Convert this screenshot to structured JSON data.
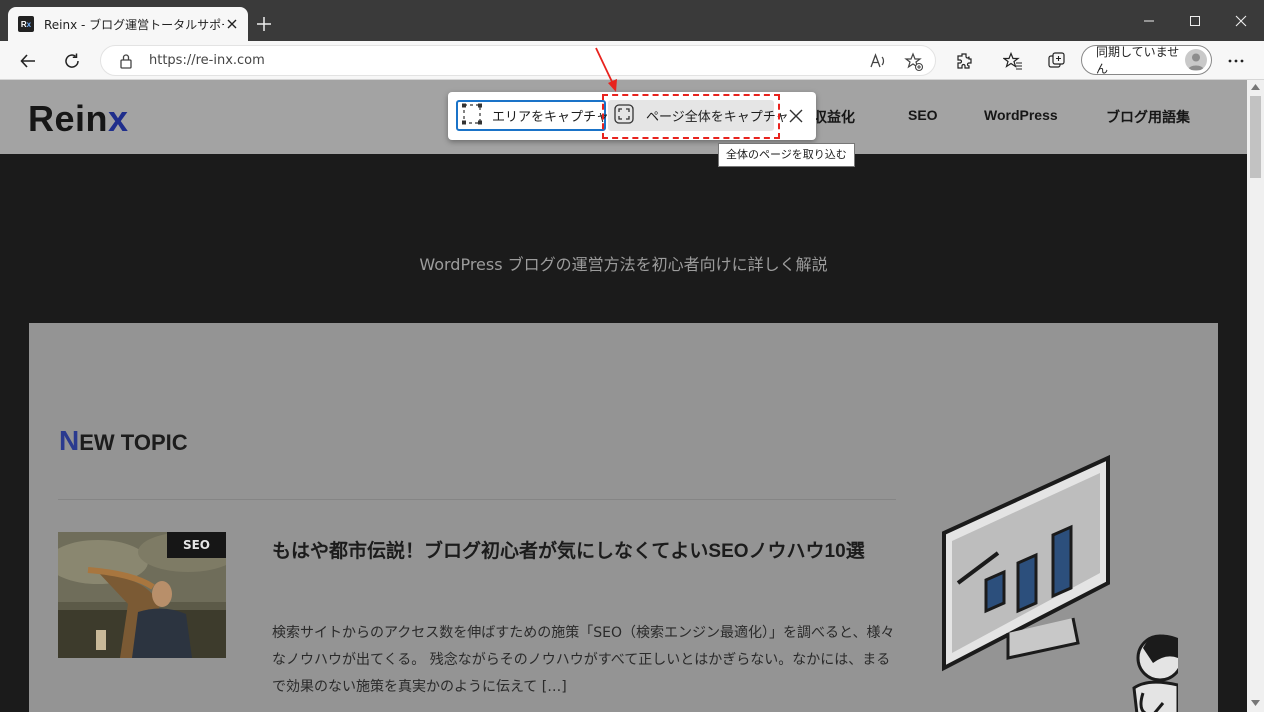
{
  "browser": {
    "tab_title": "Reinx - ブログ運営トータルサポート",
    "favicon_text": "Rx",
    "url": "https://re-inx.com",
    "sync_label": "同期していません"
  },
  "site": {
    "logo_main": "Rein",
    "logo_accent": "x",
    "nav": [
      "収益化",
      "SEO",
      "WordPress",
      "ブログ用語集"
    ],
    "tagline": "WordPress ブログの運営方法を初心者向けに詳しく解説",
    "section_title_cap": "N",
    "section_title_rest": "EW TOPIC",
    "article": {
      "badge": "SEO",
      "title": "もはや都市伝説！ブログ初心者が気にしなくてよいSEOノウハウ10選",
      "excerpt": "検索サイトからのアクセス数を伸ばすための施策「SEO（検索エンジン最適化）」を調べると、様々なノウハウが出てくる。 残念ながらそのノウハウがすべて正しいとはかぎらない。なかには、まるで効果のない施策を真実かのように伝えて […]"
    }
  },
  "capture": {
    "area_label": "エリアをキャプチャする",
    "full_label": "ページ全体をキャプチャ",
    "tooltip": "全体のページを取り込む"
  },
  "colors": {
    "accent_blue": "#1a73c8",
    "highlight_red": "#e8231e",
    "logo_accent": "#1f2e8c"
  }
}
